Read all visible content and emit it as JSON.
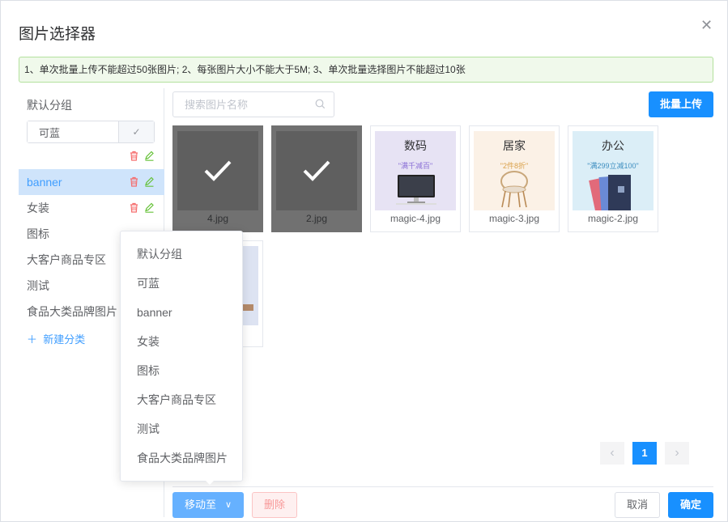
{
  "dialog": {
    "title": "图片选择器",
    "notice": "1、单次批量上传不能超过50张图片; 2、每张图片大小不能大于5M; 3、单次批量选择图片不能超过10张"
  },
  "sidebar": {
    "default_group": "默认分组",
    "edit_value": "可蓝",
    "categories": [
      {
        "label": "banner",
        "active": true
      },
      {
        "label": "女装"
      },
      {
        "label": "图标"
      },
      {
        "label": "大客户商品专区"
      },
      {
        "label": "测试"
      },
      {
        "label": "食品大类品牌图片"
      }
    ],
    "new_category": "新建分类"
  },
  "toolbar": {
    "search_placeholder": "搜索图片名称",
    "upload_label": "批量上传"
  },
  "images": [
    {
      "name": "4.jpg",
      "selected": true
    },
    {
      "name": "2.jpg",
      "selected": true
    },
    {
      "name": "magic-4.jpg",
      "title": "数码",
      "subtitle": "\"满千减百\""
    },
    {
      "name": "magic-3.jpg",
      "title": "居家",
      "subtitle": "\"2件8折\""
    },
    {
      "name": "magic-2.jpg",
      "title": "办公",
      "subtitle": "\"满299立减100\""
    }
  ],
  "pagination": {
    "prev": "‹",
    "current": "1",
    "next": "›"
  },
  "footer": {
    "move_label": "移动至",
    "delete_label": "删除",
    "cancel_label": "取消",
    "confirm_label": "确定"
  },
  "dropdown": {
    "items": [
      "默认分组",
      "可蓝",
      "banner",
      "女装",
      "图标",
      "大客户商品专区",
      "测试",
      "食品大类品牌图片"
    ]
  },
  "colors": {
    "primary": "#1890ff",
    "active_bg": "#cfe4fb",
    "danger": "#f56c6c",
    "edit": "#67c23a",
    "notice_bg": "#f0f9eb"
  }
}
